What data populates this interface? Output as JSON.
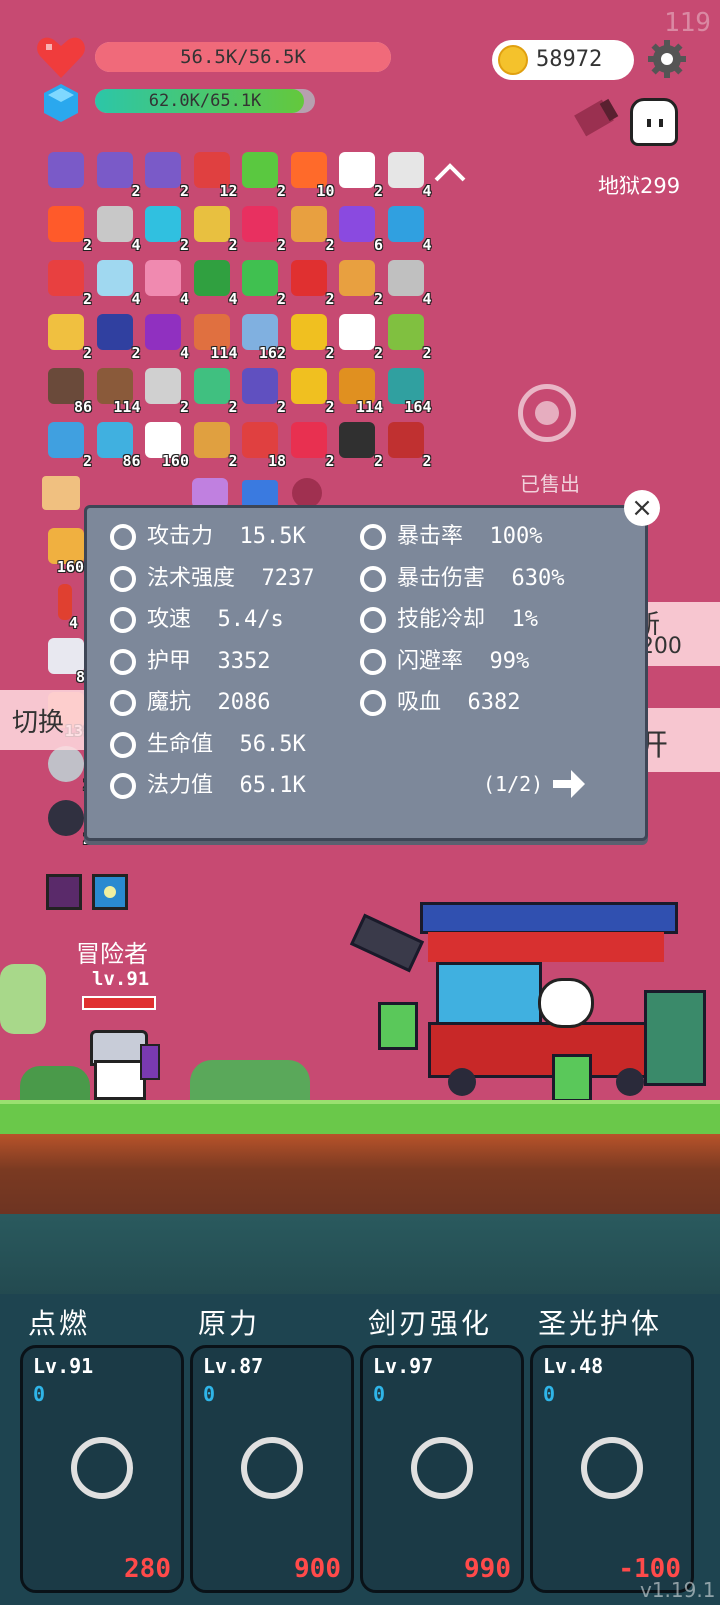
{
  "fps": "119",
  "hud": {
    "hp_text": "56.5K/56.5K",
    "hp_fraction": 1.0,
    "mp_text": "62.0K/65.1K",
    "mp_fraction": 0.952,
    "coins": "58972",
    "hell_label": "地狱299"
  },
  "items": [
    {
      "icon": "scroll-icon",
      "count": "",
      "color": "#7a5ac8"
    },
    {
      "icon": "scroll-icon",
      "count": "2",
      "color": "#7a5ac8"
    },
    {
      "icon": "scroll-icon",
      "count": "2",
      "color": "#7a5ac8"
    },
    {
      "icon": "shield-icon",
      "count": "12",
      "color": "#e04040"
    },
    {
      "icon": "lime-icon",
      "count": "2",
      "color": "#5ac840"
    },
    {
      "icon": "fire-ring-icon",
      "count": "10",
      "color": "#ff6a2a"
    },
    {
      "icon": "speech-bubble-icon",
      "count": "2",
      "color": "#ffffff"
    },
    {
      "icon": "bulb-icon",
      "count": "4",
      "color": "#e6e6e6"
    },
    {
      "icon": "fire-icon",
      "count": "2",
      "color": "#ff5a2a"
    },
    {
      "icon": "swords-icon",
      "count": "4",
      "color": "#c8c8c8"
    },
    {
      "icon": "cycle-icon",
      "count": "2",
      "color": "#30c0e0"
    },
    {
      "icon": "ring-icon",
      "count": "2",
      "color": "#e8c040"
    },
    {
      "icon": "gem-icon",
      "count": "2",
      "color": "#e83060"
    },
    {
      "icon": "bow-icon",
      "count": "2",
      "color": "#e8a040"
    },
    {
      "icon": "chest-icon",
      "count": "6",
      "color": "#8a4ae0"
    },
    {
      "icon": "target-icon",
      "count": "4",
      "color": "#30a0e0"
    },
    {
      "icon": "pin-icon",
      "count": "2",
      "color": "#e84040"
    },
    {
      "icon": "cloud-icon",
      "count": "4",
      "color": "#a0d8f0"
    },
    {
      "icon": "calendar-icon",
      "count": "4",
      "color": "#f08ab0"
    },
    {
      "icon": "snake-icon",
      "count": "4",
      "color": "#30a040"
    },
    {
      "icon": "card-icon",
      "count": "2",
      "color": "#40c050"
    },
    {
      "icon": "magnet-icon",
      "count": "2",
      "color": "#e03030"
    },
    {
      "icon": "crown-icon",
      "count": "2",
      "color": "#e8a040"
    },
    {
      "icon": "tools-icon",
      "count": "4",
      "color": "#c0c0c0"
    },
    {
      "icon": "wand-icon",
      "count": "2",
      "color": "#f0c040"
    },
    {
      "icon": "book-icon",
      "count": "2",
      "color": "#3040a0"
    },
    {
      "icon": "potion-icon",
      "count": "4",
      "color": "#9030c0"
    },
    {
      "icon": "claw-icon",
      "count": "114",
      "color": "#e07040"
    },
    {
      "icon": "slime-icon",
      "count": "162",
      "color": "#80b0e0"
    },
    {
      "icon": "sun-icon",
      "count": "2",
      "color": "#f0c020"
    },
    {
      "icon": "cards-icon",
      "count": "2",
      "color": "#ffffff"
    },
    {
      "icon": "egg-icon",
      "count": "2",
      "color": "#80c040"
    },
    {
      "icon": "coconut-icon",
      "count": "86",
      "color": "#6a4a3a"
    },
    {
      "icon": "shield-round-icon",
      "count": "114",
      "color": "#8a5a3a"
    },
    {
      "icon": "molecule-icon",
      "count": "2",
      "color": "#d0d0d0"
    },
    {
      "icon": "figure-icon",
      "count": "2",
      "color": "#40c080"
    },
    {
      "icon": "wizard-hat-icon",
      "count": "2",
      "color": "#6050c0"
    },
    {
      "icon": "gold-crown-icon",
      "count": "2",
      "color": "#f0c020"
    },
    {
      "icon": "spellbook-icon",
      "count": "114",
      "color": "#e09020"
    },
    {
      "icon": "disc-icon",
      "count": "164",
      "color": "#30a0a0"
    },
    {
      "icon": "shirt-icon",
      "count": "2",
      "color": "#40a0e0"
    },
    {
      "icon": "syringe-icon",
      "count": "86",
      "color": "#40b0e0"
    },
    {
      "icon": "ghost-icon",
      "count": "160",
      "color": "#ffffff"
    },
    {
      "icon": "briefcase-icon",
      "count": "2",
      "color": "#e0a040"
    },
    {
      "icon": "pill-icon",
      "count": "18",
      "color": "#e04040"
    },
    {
      "icon": "heart-fire-icon",
      "count": "2",
      "color": "#e83050"
    },
    {
      "icon": "bat-icon",
      "count": "2",
      "color": "#303030"
    },
    {
      "icon": "armor-icon",
      "count": "2",
      "color": "#c03030"
    }
  ],
  "sold_label": "已售出",
  "side_tabs": {
    "switch_label": "切换",
    "refresh_label": "新",
    "refresh_cost": "-200",
    "open_label": "开"
  },
  "stats": {
    "left": [
      {
        "icon": "axe-icon",
        "label": "攻击力",
        "value": "15.5K"
      },
      {
        "icon": "sun-burst-icon",
        "label": "法术强度",
        "value": "7237"
      },
      {
        "icon": "crosshair-bow-icon",
        "label": "攻速",
        "value": "5.4/s"
      },
      {
        "icon": "armor-shield-icon",
        "label": "护甲",
        "value": "3352"
      },
      {
        "icon": "magic-shield-icon",
        "label": "魔抗",
        "value": "2086"
      },
      {
        "icon": "heart-icon",
        "label": "生命值",
        "value": "56.5K"
      },
      {
        "icon": "mana-gem-icon",
        "label": "法力值",
        "value": "65.1K"
      }
    ],
    "right": [
      {
        "icon": "crit-icon",
        "label": "暴击率",
        "value": "100%"
      },
      {
        "icon": "crit-damage-icon",
        "label": "暴击伤害",
        "value": "630%"
      },
      {
        "icon": "hourglass-icon",
        "label": "技能冷却",
        "value": "1%"
      },
      {
        "icon": "dodge-icon",
        "label": "闪避率",
        "value": "99%"
      },
      {
        "icon": "skull-icon",
        "label": "吸血",
        "value": "6382"
      }
    ],
    "page": "(1/2)"
  },
  "player": {
    "name": "冒险者",
    "level": "lv.91"
  },
  "skills": [
    {
      "title": "点燃",
      "level": "Lv.91",
      "xp": "0",
      "cost": "280",
      "icon": "thermometer-icon"
    },
    {
      "title": "原力",
      "level": "Lv.87",
      "xp": "0",
      "cost": "900",
      "icon": "cycle-icon"
    },
    {
      "title": "剑刃强化",
      "level": "Lv.97",
      "xp": "0",
      "cost": "990",
      "icon": "swords-icon"
    },
    {
      "title": "圣光护体",
      "level": "Lv.48",
      "xp": "0",
      "cost": "-100",
      "icon": "golden-angel-icon"
    }
  ],
  "version": "v1.19.1"
}
